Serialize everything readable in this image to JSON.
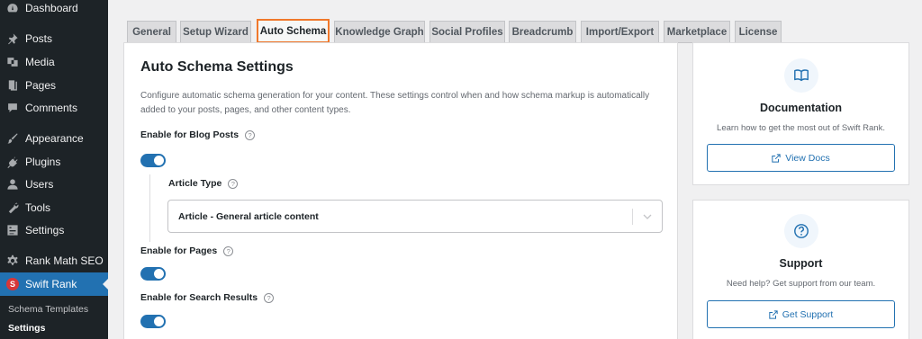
{
  "sidebar": {
    "items": [
      {
        "label": "Dashboard",
        "icon": "dashboard-icon"
      },
      {
        "label": "Posts",
        "icon": "pin-icon"
      },
      {
        "label": "Media",
        "icon": "media-icon"
      },
      {
        "label": "Pages",
        "icon": "pages-icon"
      },
      {
        "label": "Comments",
        "icon": "comment-icon"
      },
      {
        "label": "Appearance",
        "icon": "brush-icon"
      },
      {
        "label": "Plugins",
        "icon": "plugin-icon"
      },
      {
        "label": "Users",
        "icon": "user-icon"
      },
      {
        "label": "Tools",
        "icon": "wrench-icon"
      },
      {
        "label": "Settings",
        "icon": "settings-icon"
      },
      {
        "label": "Rank Math SEO",
        "icon": "gear-icon"
      },
      {
        "label": "Swift Rank",
        "icon": "swift-rank-logo-icon"
      }
    ],
    "submenu": [
      {
        "label": "Schema Templates"
      },
      {
        "label": "Settings"
      }
    ]
  },
  "tabs": [
    {
      "label": "General"
    },
    {
      "label": "Setup Wizard"
    },
    {
      "label": "Auto Schema"
    },
    {
      "label": "Knowledge Graph"
    },
    {
      "label": "Social Profiles"
    },
    {
      "label": "Breadcrumb"
    },
    {
      "label": "Import/Export"
    },
    {
      "label": "Marketplace"
    },
    {
      "label": "License"
    }
  ],
  "main": {
    "title": "Auto Schema Settings",
    "description": "Configure automatic schema generation for your content. These settings control when and how schema markup is automatically added to your posts, pages, and other content types.",
    "blog_posts_label": "Enable for Blog Posts",
    "article_type_label": "Article Type",
    "article_type_value": "Article - General article content",
    "pages_label": "Enable for Pages",
    "search_results_label": "Enable for Search Results",
    "help_glyph": "?"
  },
  "docs_card": {
    "title": "Documentation",
    "description": "Learn how to get the most out of Swift Rank.",
    "button_label": "View Docs"
  },
  "support_card": {
    "title": "Support",
    "description": "Need help? Get support from our team.",
    "button_label": "Get Support"
  },
  "colors": {
    "accent": "#2271b1",
    "active_tab_border": "#f0782b",
    "sidebar_bg": "#1d2327"
  }
}
